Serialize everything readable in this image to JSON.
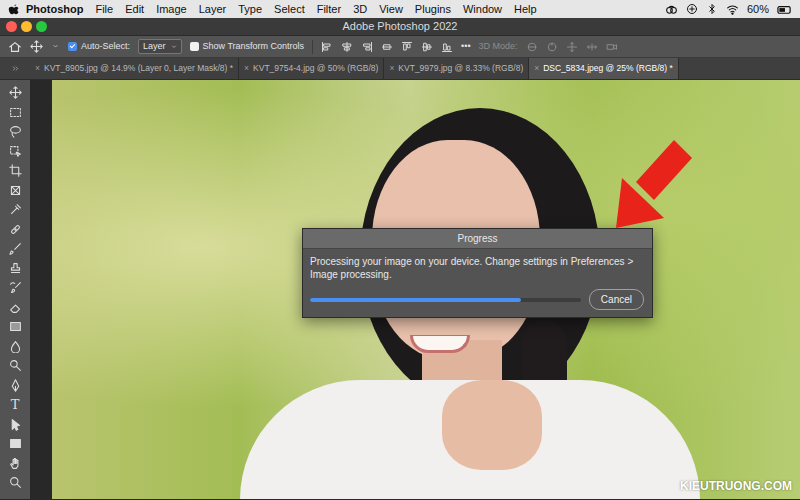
{
  "menu_bar": {
    "app": "Photoshop",
    "items": [
      "File",
      "Edit",
      "Image",
      "Layer",
      "Type",
      "Select",
      "Filter",
      "3D",
      "View",
      "Plugins",
      "Window",
      "Help"
    ],
    "battery": "60%"
  },
  "window": {
    "title": "Adobe Photoshop 2022"
  },
  "options_bar": {
    "auto_select": {
      "label": "Auto-Select:",
      "checked": true
    },
    "target": {
      "value": "Layer"
    },
    "transform": {
      "label": "Show Transform Controls",
      "checked": false
    },
    "more": "•••",
    "mode_3d": {
      "label": "3D Mode:",
      "disabled": true
    }
  },
  "tabs": [
    {
      "label": "KVT_8905.jpg @ 14.9% (Layer 0, Layer Mask/8) *",
      "close": "×",
      "selected": false
    },
    {
      "label": "KVT_9754-4.jpg @ 50% (RGB/8)",
      "close": "×",
      "selected": false
    },
    {
      "label": "KVT_9979.jpg @ 8.33% (RGB/8)",
      "close": "×",
      "selected": false
    },
    {
      "label": "DSC_5834.jpeg @ 25% (RGB/8) *",
      "close": "×",
      "selected": true
    }
  ],
  "toolbar": {
    "type_glyph": "T"
  },
  "dialog": {
    "title": "Progress",
    "message": "Processing your image on your device. Change settings in Preferences > Image processing.",
    "level": 0.78,
    "buttons": [
      "Cancel"
    ]
  },
  "watermark": "KIEUTRUONG.COM"
}
